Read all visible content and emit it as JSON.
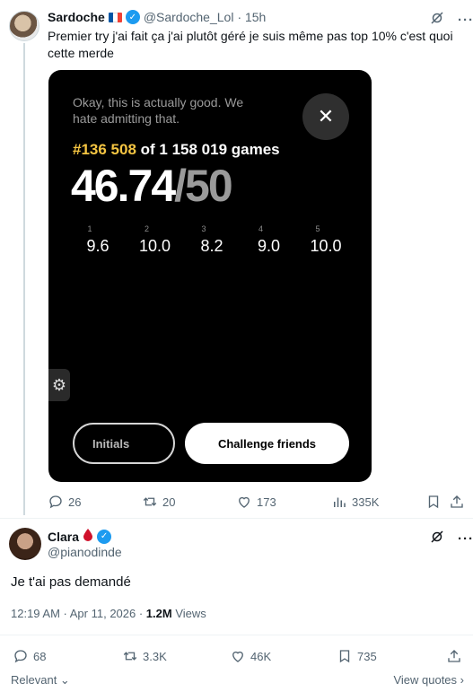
{
  "tweet1": {
    "name": "Sardoche",
    "flag": [
      "#0055a4",
      "#ffffff",
      "#ef4135"
    ],
    "handle": "@Sardoche_Lol",
    "time": "· 15h",
    "text": "Premier try j'ai fait ça j'ai plutôt géré je suis même pas top 10% c'est quoi cette merde",
    "card": {
      "message": "Okay, this is actually good. We hate admitting that.",
      "rank": "#136 508",
      "rank_suffix": " of 1 158 019 games",
      "score": "46.74",
      "score_max": "/50",
      "rounds": [
        {
          "index": "1",
          "value": "9.6"
        },
        {
          "index": "2",
          "value": "10.0"
        },
        {
          "index": "3",
          "value": "8.2"
        },
        {
          "index": "4",
          "value": "9.0"
        },
        {
          "index": "5",
          "value": "10.0"
        }
      ],
      "initials_label": "Initials",
      "challenge_label": "Challenge friends"
    },
    "stats": {
      "replies": "26",
      "retweets": "20",
      "likes": "173",
      "views": "335K"
    }
  },
  "tweet2": {
    "name": "Clara",
    "handle": "@pianodinde",
    "text": "Je t'ai pas demandé",
    "time": "12:19 AM · Apr 11, 2026 · ",
    "views_count": "1.2M",
    "views_label": " Views",
    "stats": {
      "replies": "68",
      "retweets": "3.3K",
      "likes": "46K",
      "bookmarks": "735"
    }
  },
  "footer": {
    "sort_label": "Relevant",
    "view_quotes": "View quotes"
  },
  "icons": [
    "grok-icon",
    "more-icon",
    "reply-icon",
    "retweet-icon",
    "like-icon",
    "views-icon",
    "bookmark-icon",
    "share-icon",
    "close-icon",
    "gear-icon",
    "verified-icon",
    "drop-icon"
  ]
}
